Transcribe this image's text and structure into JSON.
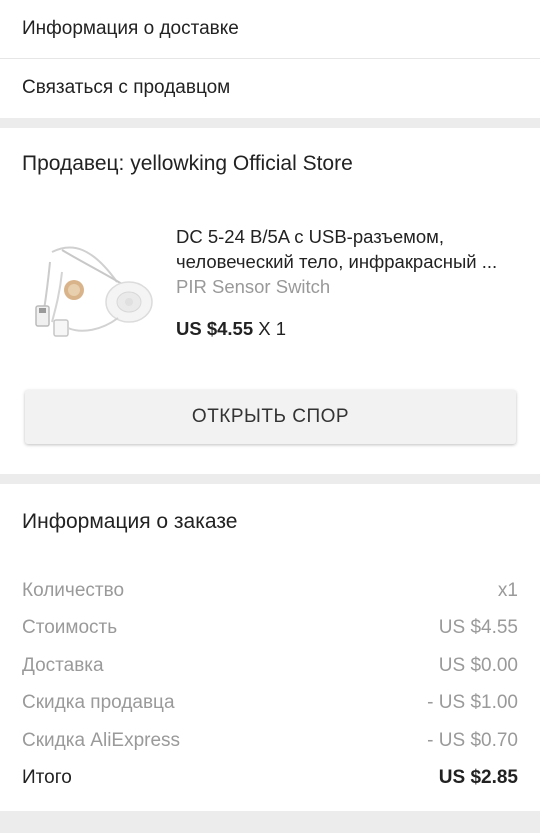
{
  "links": {
    "delivery_info": "Информация о доставке",
    "contact_seller": "Связаться с продавцом"
  },
  "seller": {
    "title": "Продавец: yellowking Official Store",
    "product": {
      "title_line1": "DC 5-24 В/5A с USB-разъемом,",
      "title_line2": "человеческий тело, инфракрасный ...",
      "variant": "PIR Sensor Switch",
      "price": "US $4.55",
      "qty": "X 1"
    },
    "dispute_button": "ОТКРЫТЬ СПОР"
  },
  "order": {
    "title": "Информация о заказе",
    "rows": [
      {
        "label": "Количество",
        "value": "x1"
      },
      {
        "label": "Стоимость",
        "value": "US $4.55"
      },
      {
        "label": "Доставка",
        "value": "US $0.00"
      },
      {
        "label": "Скидка продавца",
        "value": "- US $1.00"
      },
      {
        "label": "Скидка AliExpress",
        "value": "- US $0.70"
      }
    ],
    "total": {
      "label": "Итого",
      "value": "US $2.85"
    }
  },
  "colors": {
    "background": "#ececec",
    "card": "#ffffff",
    "muted_text": "#9a9a9a",
    "button_bg": "#f2f2f2"
  }
}
